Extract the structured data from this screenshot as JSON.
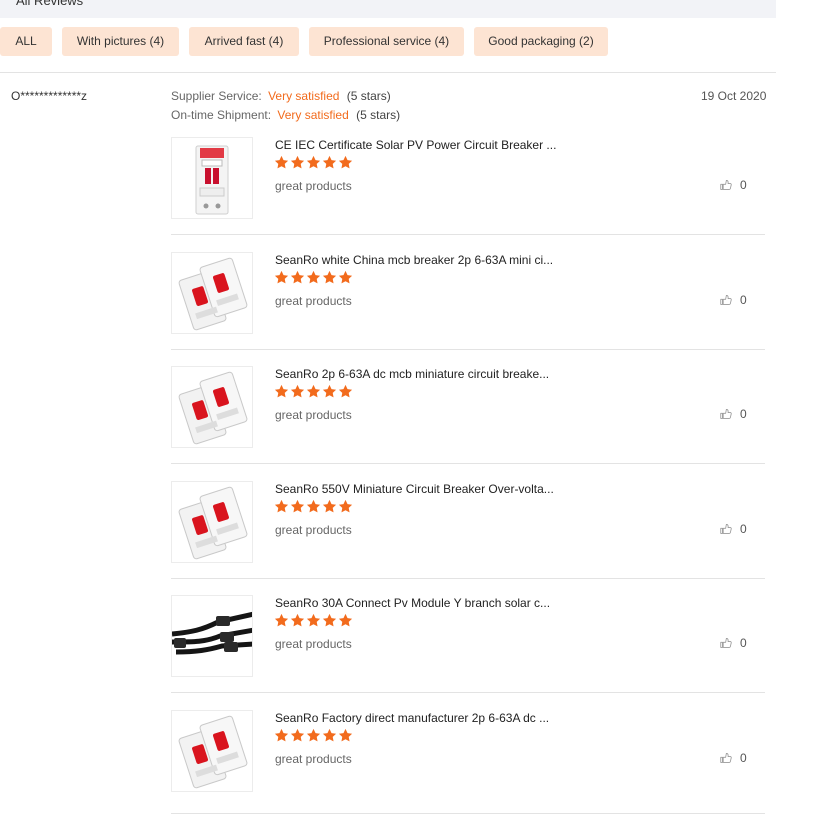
{
  "header": {
    "title": "All Reviews"
  },
  "filters": [
    {
      "label": "ALL"
    },
    {
      "label": "With pictures (4)"
    },
    {
      "label": "Arrived fast (4)"
    },
    {
      "label": "Professional service (4)"
    },
    {
      "label": "Good packaging (2)"
    }
  ],
  "review": {
    "reviewer": "O*************z",
    "date": "19 Oct 2020",
    "supplier_service": {
      "label": "Supplier Service:",
      "value": "Very satisfied",
      "stars": "(5 stars)"
    },
    "ontime_shipment": {
      "label": "On-time Shipment:",
      "value": "Very satisfied",
      "stars": "(5 stars)"
    },
    "items": [
      {
        "title": "CE IEC Certificate Solar PV Power Circuit Breaker ...",
        "rating": 5,
        "comment": "great products",
        "likes": "0",
        "image": "breaker-single-icon"
      },
      {
        "title": "SeanRo white China mcb breaker 2p 6-63A mini ci...",
        "rating": 5,
        "comment": "great products",
        "likes": "0",
        "image": "breaker-pair-icon"
      },
      {
        "title": "SeanRo 2p 6-63A dc mcb miniature circuit breake...",
        "rating": 5,
        "comment": "great products",
        "likes": "0",
        "image": "breaker-pair-icon"
      },
      {
        "title": "SeanRo 550V Miniature Circuit Breaker Over-volta...",
        "rating": 5,
        "comment": "great products",
        "likes": "0",
        "image": "breaker-pair-icon"
      },
      {
        "title": "SeanRo 30A Connect Pv Module Y branch solar c...",
        "rating": 5,
        "comment": "great products",
        "likes": "0",
        "image": "y-branch-cable-icon"
      },
      {
        "title": "SeanRo Factory direct manufacturer 2p 6-63A dc ...",
        "rating": 5,
        "comment": "great products",
        "likes": "0",
        "image": "breaker-pair-icon"
      }
    ]
  },
  "colors": {
    "accent": "#f26b1d",
    "chip_bg": "#fde4d3",
    "star": "#f26b1d",
    "header_bg": "#f2f3f7"
  }
}
